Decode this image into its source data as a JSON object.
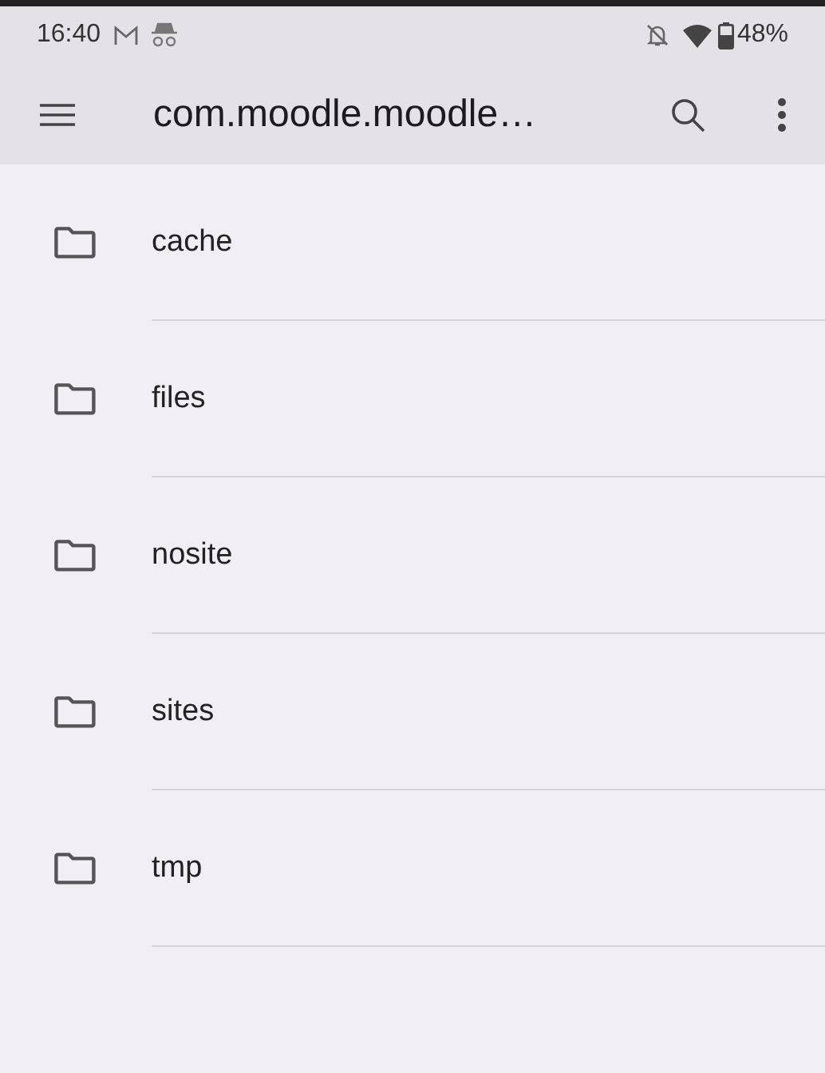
{
  "status_bar": {
    "time": "16:40",
    "battery": "48%"
  },
  "app_bar": {
    "title": "com.moodle.moodle…"
  },
  "folders": [
    {
      "name": "cache"
    },
    {
      "name": "files"
    },
    {
      "name": "nosite"
    },
    {
      "name": "sites"
    },
    {
      "name": "tmp"
    }
  ]
}
